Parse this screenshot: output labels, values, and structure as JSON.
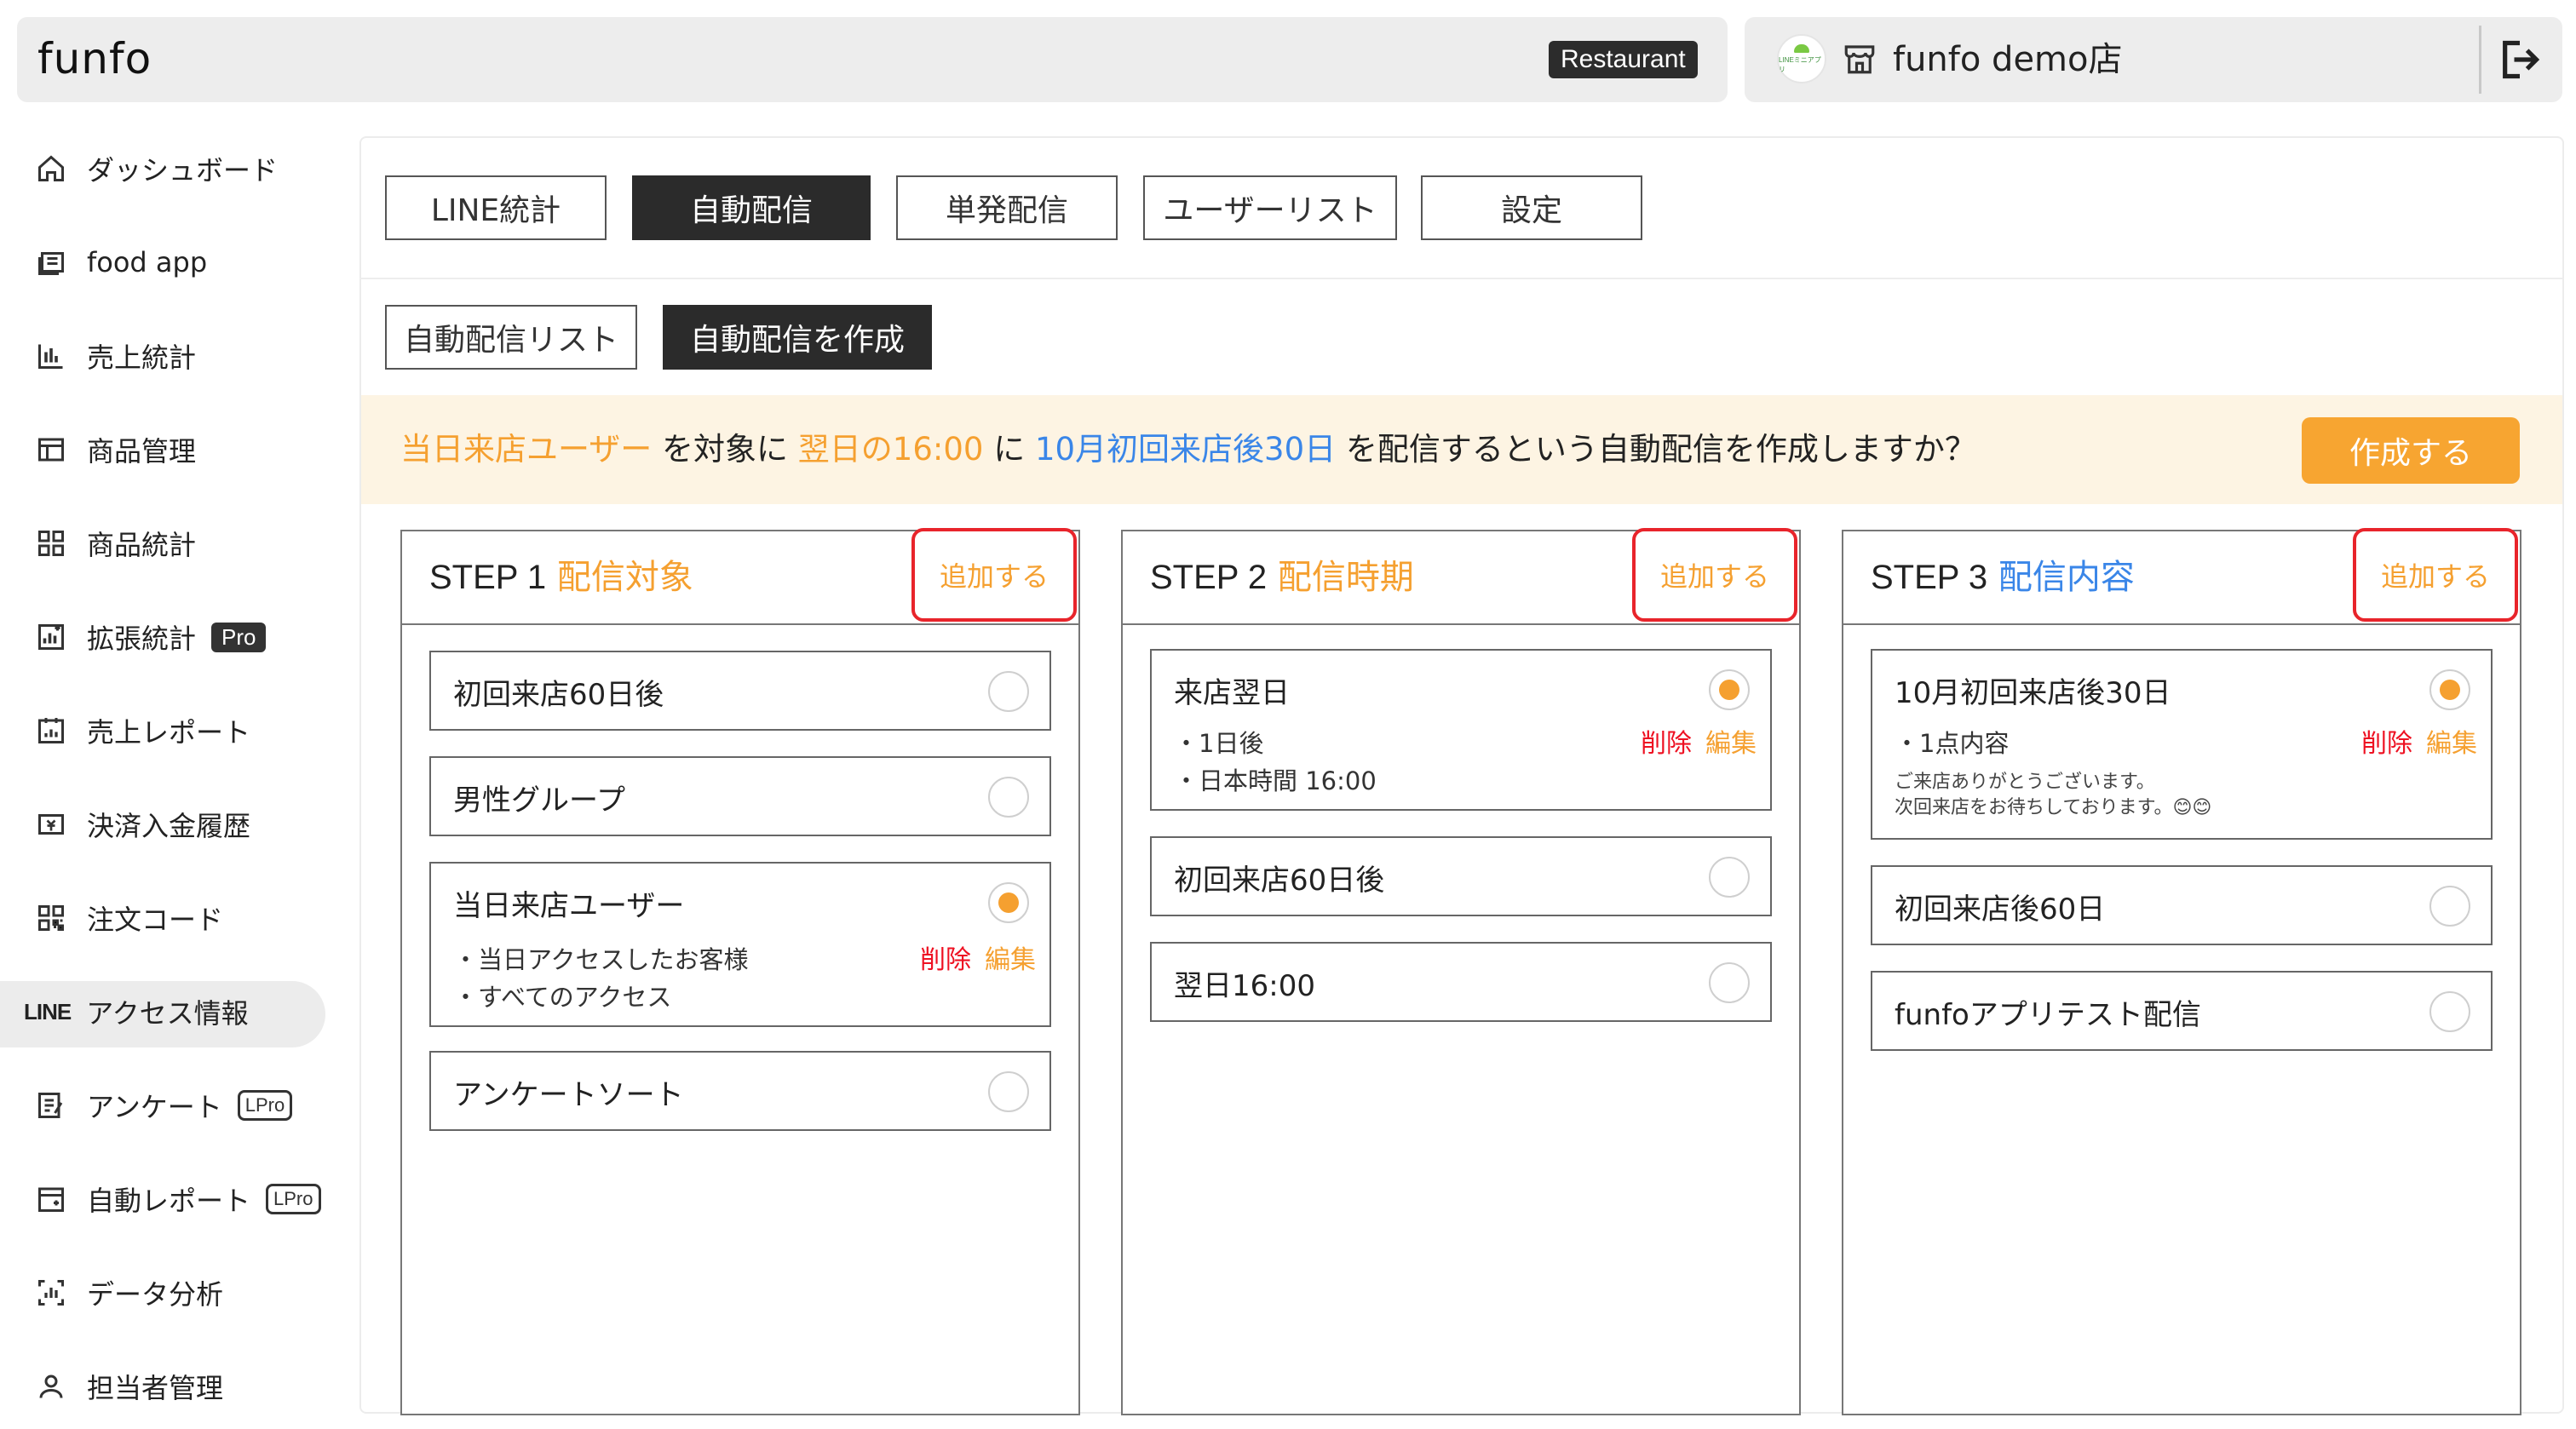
{
  "topbar": {
    "logo": "funfo",
    "badge": "Restaurant",
    "store_avatar_text": "LINEミニアプリ",
    "store_name": "funfo demo店"
  },
  "sidebar": {
    "items": [
      {
        "label": "ダッシュボード",
        "icon": "home-icon"
      },
      {
        "label": "food app",
        "icon": "food-app-icon"
      },
      {
        "label": "売上統計",
        "icon": "bar-chart-icon"
      },
      {
        "label": "商品管理",
        "icon": "product-icon"
      },
      {
        "label": "商品統計",
        "icon": "grid-icon"
      },
      {
        "label": "拡張統計",
        "icon": "chart-plus-icon",
        "badge": "Pro"
      },
      {
        "label": "売上レポート",
        "icon": "report-icon"
      },
      {
        "label": "決済入金履歴",
        "icon": "payment-icon"
      },
      {
        "label": "注文コード",
        "icon": "qr-icon"
      },
      {
        "label": "アクセス情報",
        "prefix": "LINE",
        "active": true
      },
      {
        "label": "アンケート",
        "icon": "survey-icon",
        "badge": "LPro"
      },
      {
        "label": "自動レポート",
        "icon": "auto-report-icon",
        "badge": "LPro"
      },
      {
        "label": "データ分析",
        "icon": "analytics-icon"
      },
      {
        "label": "担当者管理",
        "icon": "user-icon"
      }
    ]
  },
  "tabs": [
    "LINE統計",
    "自動配信",
    "単発配信",
    "ユーザーリスト",
    "設定"
  ],
  "active_tab": "自動配信",
  "subtabs": [
    "自動配信リスト",
    "自動配信を作成"
  ],
  "active_subtab": "自動配信を作成",
  "summary": {
    "target": "当日来店ユーザー",
    "t1": "を対象に",
    "timing": "翌日の16:00",
    "t2": "に",
    "content": "10月初回来店後30日",
    "t3": "を配信するという自動配信を作成しますか？",
    "button": "作成する"
  },
  "steps": [
    {
      "num": "STEP 1",
      "name": "配信対象",
      "add": "追加する",
      "options": [
        {
          "title": "初回来店60日後",
          "selected": false
        },
        {
          "title": "男性グループ",
          "selected": false
        },
        {
          "title": "当日来店ユーザー",
          "selected": true,
          "details": [
            "・当日アクセスしたお客様",
            "・すべてのアクセス"
          ],
          "delete": "削除",
          "edit": "編集"
        },
        {
          "title": "アンケートソート",
          "selected": false
        }
      ]
    },
    {
      "num": "STEP 2",
      "name": "配信時期",
      "add": "追加する",
      "options": [
        {
          "title": "来店翌日",
          "selected": true,
          "details": [
            "・1日後",
            "・日本時間 16:00"
          ],
          "delete": "削除",
          "edit": "編集"
        },
        {
          "title": "初回来店60日後",
          "selected": false
        },
        {
          "title": "翌日16:00",
          "selected": false
        }
      ]
    },
    {
      "num": "STEP 3",
      "name": "配信内容",
      "add": "追加する",
      "options": [
        {
          "title": "10月初回来店後30日",
          "selected": true,
          "details": [
            "・1点内容"
          ],
          "message": [
            "ご来店ありがとうございます。",
            "次回来店をお待ちしております。😊😊"
          ],
          "delete": "削除",
          "edit": "編集"
        },
        {
          "title": "初回来店後60日",
          "selected": false
        },
        {
          "title": "funfoアプリテスト配信",
          "selected": false
        }
      ]
    }
  ]
}
